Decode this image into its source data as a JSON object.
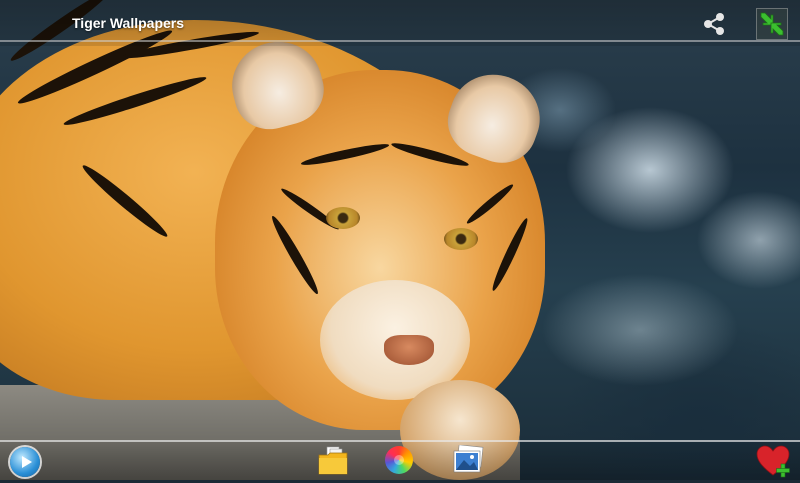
{
  "app": {
    "title": "Tiger Wallpapers"
  },
  "topbar": {
    "share_icon": "share-icon",
    "fullscreen_icon": "exit-fullscreen-arrows-icon"
  },
  "bottombar": {
    "items": [
      {
        "name": "play-slideshow-button",
        "icon": "play-circle-icon"
      },
      {
        "name": "folder-button",
        "icon": "folder-icon"
      },
      {
        "name": "color-wheel-button",
        "icon": "color-wheel-icon"
      },
      {
        "name": "gallery-button",
        "icon": "photos-icon"
      },
      {
        "name": "add-favorite-button",
        "icon": "heart-plus-icon"
      }
    ]
  },
  "colors": {
    "accent_green": "#3bbf2f",
    "favorite_red": "#d8232a",
    "play_blue": "#2a8fd6"
  }
}
